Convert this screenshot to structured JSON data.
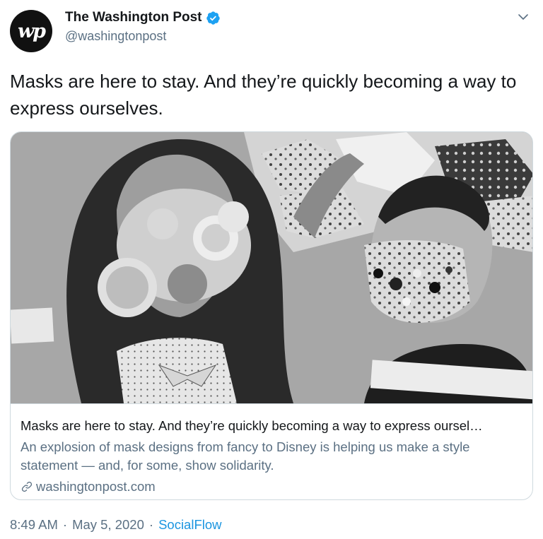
{
  "author": {
    "avatar_text": "wp",
    "name": "The Washington Post",
    "handle": "@washingtonpost",
    "verified": true
  },
  "icons": {
    "verified": "verified-badge-icon",
    "more": "chevron-down-icon",
    "link": "link-icon"
  },
  "tweet": {
    "text": "Masks are here to stay. And they’re quickly becoming a way to express ourselves."
  },
  "card": {
    "title": "Masks are here to stay. And they’re quickly becoming a way to express oursel…",
    "description": "An explosion of mask designs from fancy to Disney is helping us make a style statement — and, for some, show solidarity.",
    "domain": "washingtonpost.com"
  },
  "meta": {
    "time": "8:49 AM",
    "sep1": "·",
    "date": "May 5, 2020",
    "sep2": "·",
    "source": "SocialFlow"
  },
  "colors": {
    "accent": "#1b95e0",
    "verified": "#1da1f2",
    "secondary_text": "#5b7083",
    "border": "#cfd9de"
  }
}
